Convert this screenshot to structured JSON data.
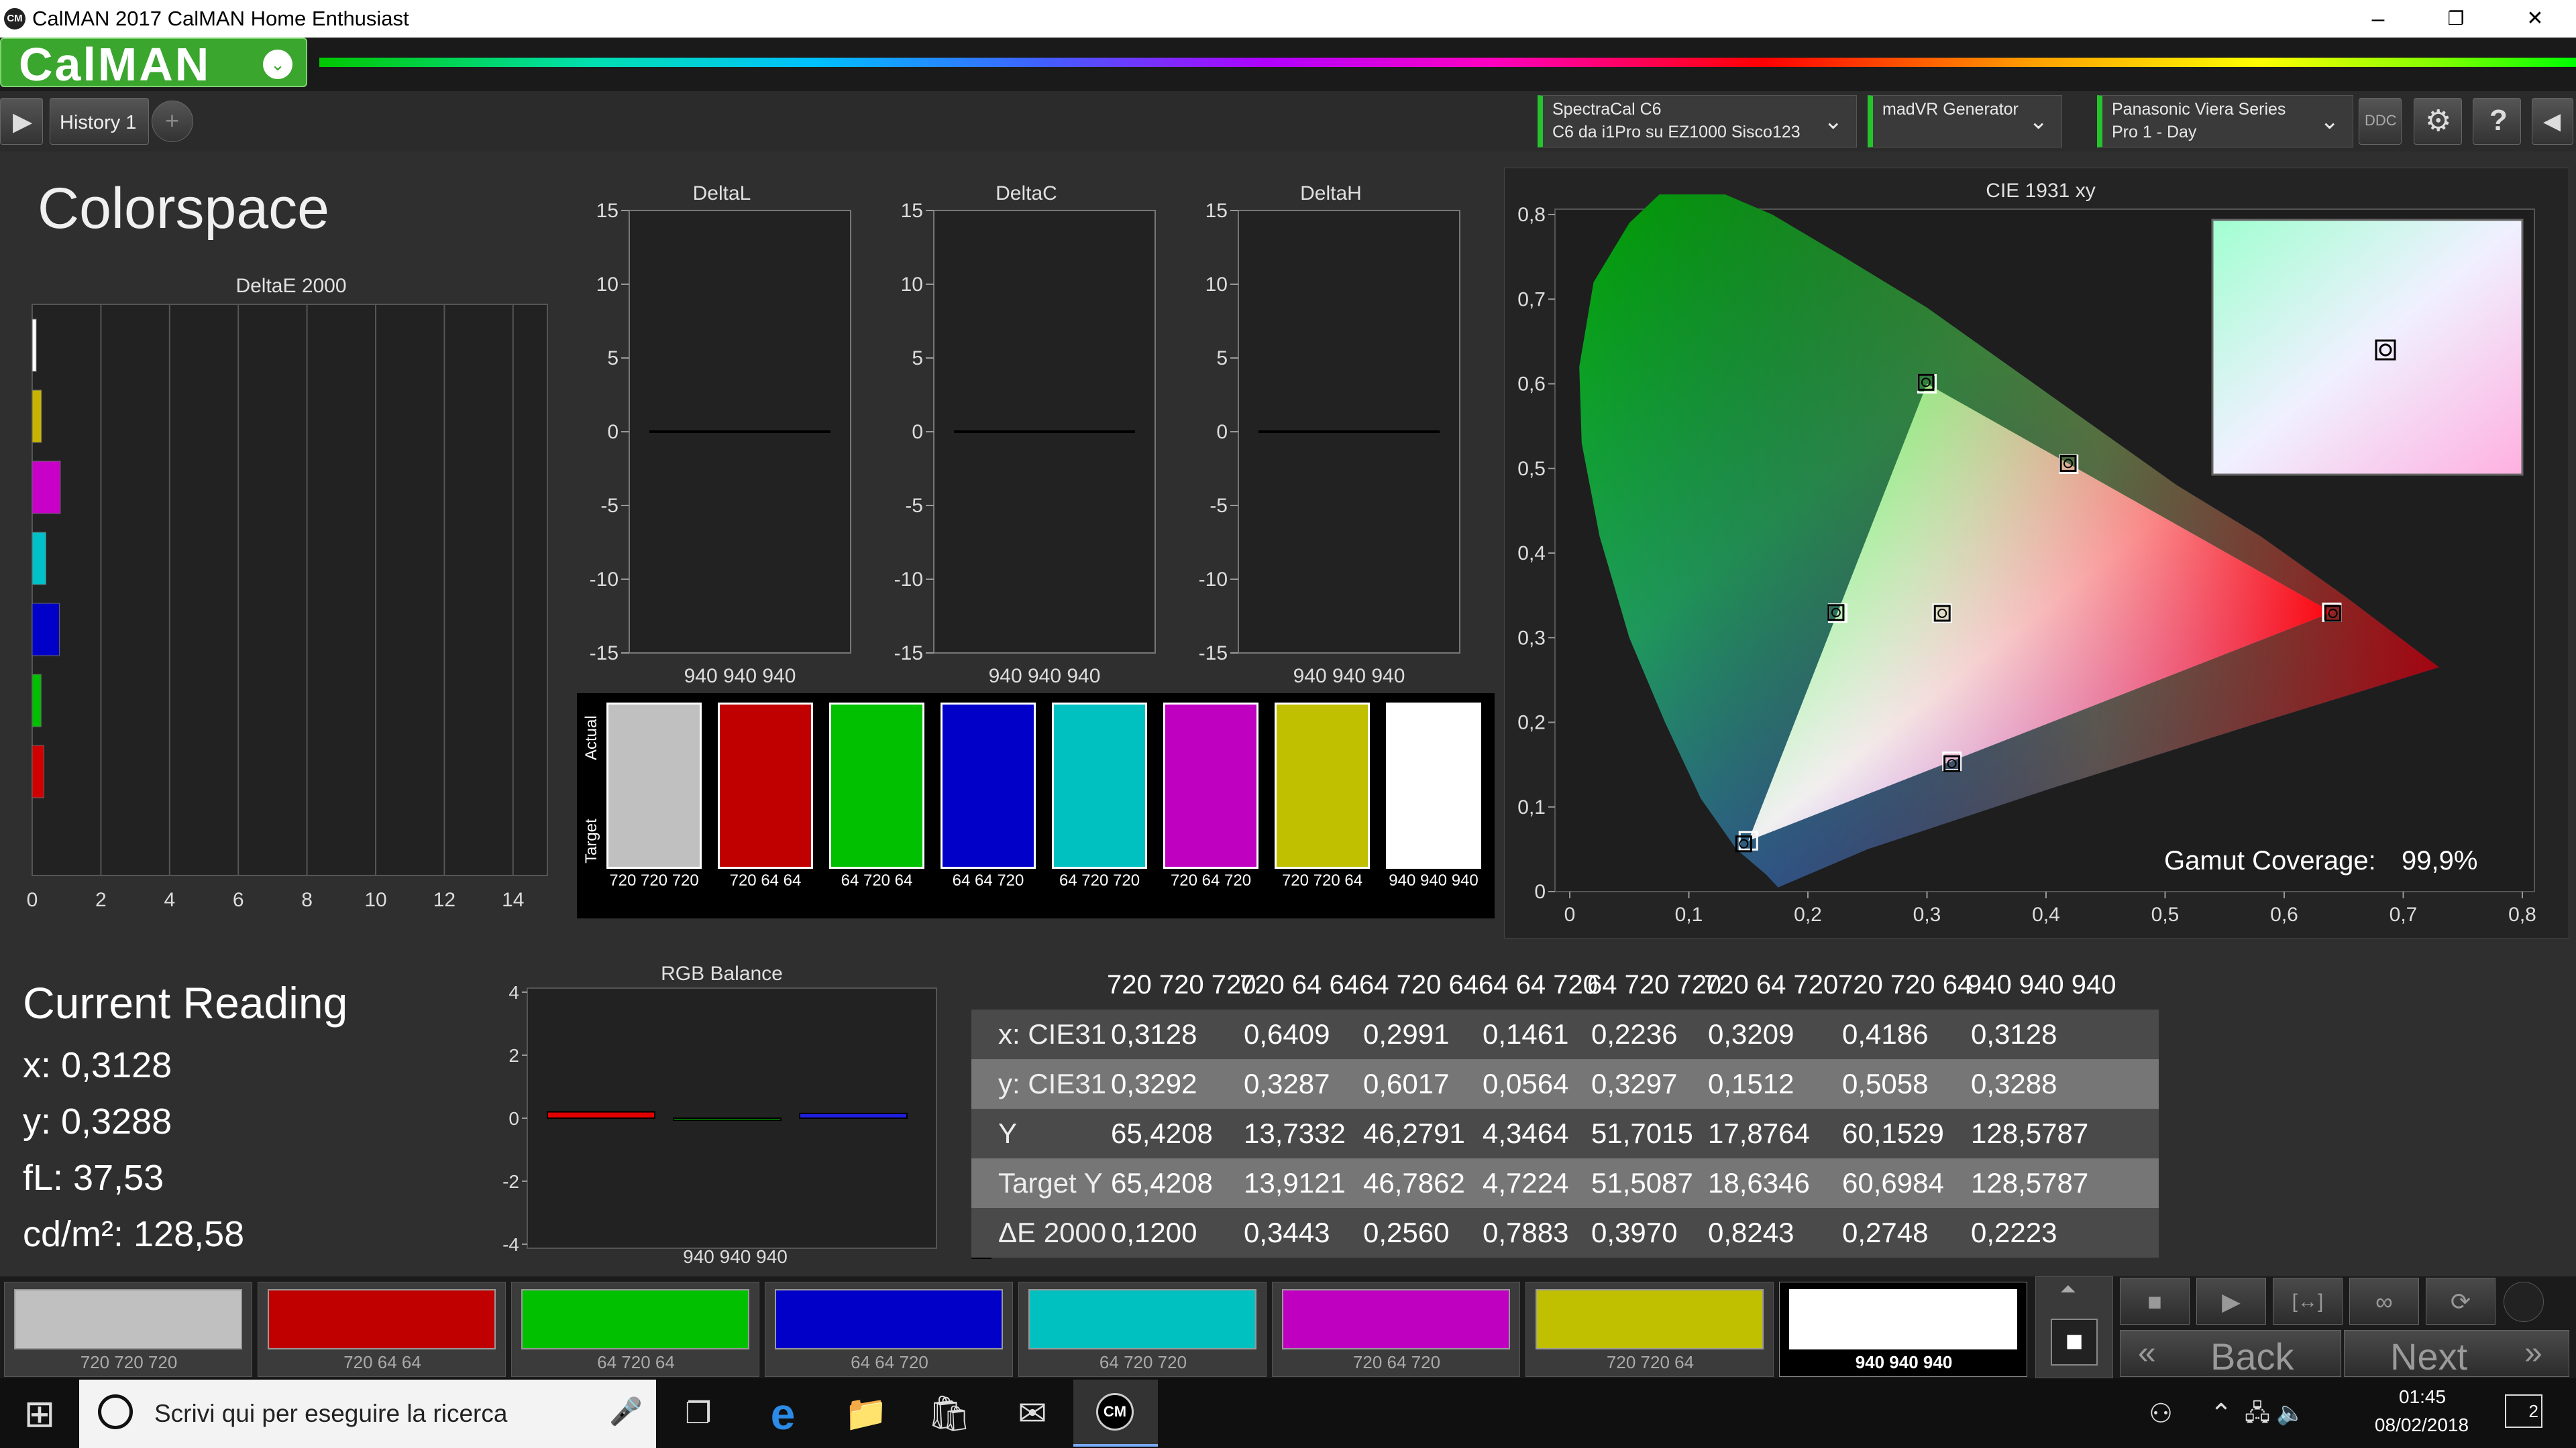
{
  "window": {
    "title": "CalMAN 2017 CalMAN Home Enthusiast",
    "logo_badge": "CM",
    "minimize": "–",
    "restore": "❐",
    "close": "✕"
  },
  "header": {
    "logo": "CalMAN",
    "logo_arrow": "⌄"
  },
  "toolbar": {
    "play": "▶",
    "tab_history": "History 1",
    "tab_add": "+",
    "devices": [
      {
        "line1": "SpectraCal C6",
        "line2": "C6 da i1Pro su EZ1000 Sisco123",
        "arrow": "⌄"
      },
      {
        "line1": "madVR Generator",
        "line2": "",
        "arrow": "⌄"
      },
      {
        "line1": "Panasonic Viera Series",
        "line2": "Pro 1 - Day",
        "arrow": "⌄"
      }
    ],
    "ddc": "DDC",
    "settings": "⚙",
    "help": "?",
    "collapse": "◀"
  },
  "page": {
    "title": "Colorspace"
  },
  "deltae_chart": {
    "title": "DeltaE 2000",
    "xticks": [
      "0",
      "2",
      "4",
      "6",
      "8",
      "10",
      "12",
      "14"
    ],
    "xlim": [
      0,
      15
    ],
    "bars": [
      {
        "color": "#ffffff",
        "value": 0.12
      },
      {
        "color": "#c8b400",
        "value": 0.27
      },
      {
        "color": "#c800c8",
        "value": 0.82
      },
      {
        "color": "#00c0c8",
        "value": 0.4
      },
      {
        "color": "#0000c8",
        "value": 0.79
      },
      {
        "color": "#00c000",
        "value": 0.26
      },
      {
        "color": "#d00000",
        "value": 0.34
      }
    ]
  },
  "delta_charts": [
    {
      "title": "DeltaL",
      "xlabel": "940 940 940"
    },
    {
      "title": "DeltaC",
      "xlabel": "940 940 940"
    },
    {
      "title": "DeltaH",
      "xlabel": "940 940 940"
    }
  ],
  "delta_yticks": [
    "15",
    "10",
    "5",
    "0",
    "-5",
    "-10",
    "-15"
  ],
  "swatches": {
    "actual_label": "Actual",
    "target_label": "Target",
    "items": [
      {
        "color": "#c0c0c0",
        "label": "720 720 720"
      },
      {
        "color": "#c00000",
        "label": "720 64 64"
      },
      {
        "color": "#00c000",
        "label": "64 720 64"
      },
      {
        "color": "#0000c8",
        "label": "64 64 720"
      },
      {
        "color": "#00c0c0",
        "label": "64 720 720"
      },
      {
        "color": "#c000c0",
        "label": "720 64 720"
      },
      {
        "color": "#c0c000",
        "label": "720 720 64"
      },
      {
        "color": "#ffffff",
        "label": "940 940 940"
      }
    ]
  },
  "cie": {
    "title": "CIE 1931 xy",
    "xticks": [
      "0",
      "0,1",
      "0,2",
      "0,3",
      "0,4",
      "0,5",
      "0,6",
      "0,7",
      "0,8"
    ],
    "yticks": [
      "0,8",
      "0,7",
      "0,6",
      "0,5",
      "0,4",
      "0,3",
      "0,2",
      "0,1",
      "0"
    ],
    "gamut_label": "Gamut Coverage:",
    "gamut_value": "99,9%"
  },
  "chart_data": [
    {
      "type": "bar",
      "title": "DeltaE 2000",
      "orientation": "horizontal",
      "categories": [
        "940 940 940",
        "720 720 64",
        "720 64 720",
        "64 720 720",
        "64 64 720",
        "64 720 64",
        "720 64 64"
      ],
      "values": [
        0.22,
        0.27,
        0.82,
        0.4,
        0.79,
        0.26,
        0.34
      ],
      "xlim": [
        0,
        15
      ]
    },
    {
      "type": "bar",
      "title": "RGB Balance",
      "categories": [
        "R",
        "G",
        "B"
      ],
      "values": [
        0.2,
        -0.05,
        0.15
      ],
      "xlabel": "940 940 940",
      "ylim": [
        -4,
        4
      ]
    },
    {
      "type": "scatter",
      "title": "CIE 1931 xy",
      "series": [
        {
          "x": [
            0.64,
            0.3,
            0.15
          ],
          "y": [
            0.33,
            0.6,
            0.06
          ]
        },
        {
          "x": [
            0.6409,
            0.2991,
            0.1461,
            0.2236,
            0.3209,
            0.4186,
            0.3128
          ],
          "y": [
            0.3287,
            0.6017,
            0.0564,
            0.3297,
            0.1512,
            0.5058,
            0.3288
          ]
        }
      ],
      "xlim": [
        0,
        0.8
      ],
      "ylim": [
        0,
        0.8
      ]
    }
  ],
  "rgb_balance": {
    "title": "RGB Balance",
    "yticks": [
      "4",
      "2",
      "0",
      "-2",
      "-4"
    ],
    "xlabel": "940 940 940"
  },
  "current_reading": {
    "title": "Current Reading",
    "x": "x: 0,3128",
    "y": "y: 0,3288",
    "fl": "fL: 37,53",
    "cdm2": "cd/m²: 128,58"
  },
  "table": {
    "headers": [
      "720 720 720",
      "720 64 64",
      "64 720 64",
      "64 64 720",
      "64 720 720",
      "720 64 720",
      "720 720 64",
      "940 940 940"
    ],
    "rows": [
      {
        "label": "x: CIE31",
        "values": [
          "0,3128",
          "0,6409",
          "0,2991",
          "0,1461",
          "0,2236",
          "0,3209",
          "0,4186",
          "0,3128"
        ]
      },
      {
        "label": "y: CIE31",
        "values": [
          "0,3292",
          "0,3287",
          "0,6017",
          "0,0564",
          "0,3297",
          "0,1512",
          "0,5058",
          "0,3288"
        ]
      },
      {
        "label": "Y",
        "values": [
          "65,4208",
          "13,7332",
          "46,2791",
          "4,3464",
          "51,7015",
          "17,8764",
          "60,1529",
          "128,5787"
        ]
      },
      {
        "label": "Target Y",
        "values": [
          "65,4208",
          "13,9121",
          "46,7862",
          "4,7224",
          "51,5087",
          "18,6346",
          "60,6984",
          "128,5787"
        ]
      },
      {
        "label": "ΔE 2000",
        "values": [
          "0,1200",
          "0,3443",
          "0,2560",
          "0,7883",
          "0,3970",
          "0,8243",
          "0,2748",
          "0,2223"
        ]
      }
    ]
  },
  "patches": [
    {
      "color": "#c0c0c0",
      "label": "720 720 720"
    },
    {
      "color": "#c00000",
      "label": "720 64 64"
    },
    {
      "color": "#00c000",
      "label": "64 720 64"
    },
    {
      "color": "#0000c8",
      "label": "64 64 720"
    },
    {
      "color": "#00c0c0",
      "label": "64 720 720"
    },
    {
      "color": "#c000c0",
      "label": "720 64 720"
    },
    {
      "color": "#c0c000",
      "label": "720 720 64"
    },
    {
      "color": "#ffffff",
      "label": "940 940 940"
    }
  ],
  "controls": {
    "up": "⏶",
    "stop_big": "■",
    "stop": "■",
    "play": "▶",
    "step": "[↔]",
    "loop": "∞",
    "refresh": "⟳",
    "back": "Back",
    "back_glyph": "«",
    "next": "Next",
    "next_glyph": "»"
  },
  "taskbar": {
    "start": "⊞",
    "search_placeholder": "Scrivi qui per eseguire la ricerca",
    "mic": "🎤",
    "task_view": "❐",
    "edge": "e",
    "explorer": "📁",
    "store": "🛍",
    "mail": "✉",
    "calman": "CM",
    "people": "⚇",
    "tray_up": "⌃",
    "tray_icons": "🖧 🔈",
    "time": "01:45",
    "date": "08/02/2018",
    "notif": "2"
  }
}
